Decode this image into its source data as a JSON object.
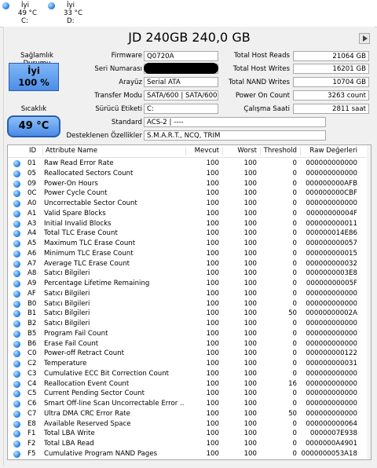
{
  "drives": [
    {
      "status": "İyi",
      "temp": "49 °C",
      "letter": "C:"
    },
    {
      "status": "İyi",
      "temp": "33 °C",
      "letter": "D:"
    }
  ],
  "title": "JD 240GB 240,0 GB",
  "health": {
    "label": "Sağlamlık Durumu",
    "status": "İyi",
    "percent": "100 %"
  },
  "temperature": {
    "label": "Sıcaklık",
    "value": "49 °C"
  },
  "info": {
    "firmware": {
      "label": "Firmware",
      "value": "Q0720A"
    },
    "serial": {
      "label": "Seri Numarası",
      "value": ""
    },
    "interface": {
      "label": "Arayüz",
      "value": "Serial ATA"
    },
    "transfer": {
      "label": "Transfer Modu",
      "value": "SATA/600 | SATA/600"
    },
    "drive_letter": {
      "label": "Sürücü Etiketi",
      "value": "C:"
    },
    "standard": {
      "label": "Standard",
      "value": "ACS-2 | ----"
    },
    "features": {
      "label": "Desteklenen Özellikler",
      "value": "S.M.A.R.T., NCQ, TRIM"
    }
  },
  "stats": {
    "host_reads": {
      "label": "Total Host Reads",
      "value": "21064 GB"
    },
    "host_writes": {
      "label": "Total Host Writes",
      "value": "16201 GB"
    },
    "nand_writes": {
      "label": "Total NAND Writes",
      "value": "10704 GB"
    },
    "power_on_count": {
      "label": "Power On Count",
      "value": "3263 count"
    },
    "power_on_hours": {
      "label": "Çalışma Saati",
      "value": "2811 saat"
    }
  },
  "columns": {
    "id": "ID",
    "attr": "Attribute Name",
    "current": "Mevcut",
    "worst": "Worst",
    "threshold": "Threshold",
    "raw": "Raw Değerleri"
  },
  "rows": [
    {
      "id": "01",
      "name": "Raw Read Error Rate",
      "cur": "100",
      "wor": "100",
      "thr": "0",
      "raw": "000000000000"
    },
    {
      "id": "05",
      "name": "Reallocated Sectors Count",
      "cur": "100",
      "wor": "100",
      "thr": "0",
      "raw": "000000000000"
    },
    {
      "id": "09",
      "name": "Power-On Hours",
      "cur": "100",
      "wor": "100",
      "thr": "0",
      "raw": "000000000AFB"
    },
    {
      "id": "0C",
      "name": "Power Cycle Count",
      "cur": "100",
      "wor": "100",
      "thr": "0",
      "raw": "000000000CBF"
    },
    {
      "id": "A0",
      "name": "Uncorrectable Sector Count",
      "cur": "100",
      "wor": "100",
      "thr": "0",
      "raw": "000000000000"
    },
    {
      "id": "A1",
      "name": "Valid Spare Blocks",
      "cur": "100",
      "wor": "100",
      "thr": "0",
      "raw": "00000000004F"
    },
    {
      "id": "A3",
      "name": "Initial Invalid Blocks",
      "cur": "100",
      "wor": "100",
      "thr": "0",
      "raw": "000000000011"
    },
    {
      "id": "A4",
      "name": "Total TLC Erase Count",
      "cur": "100",
      "wor": "100",
      "thr": "0",
      "raw": "000000014E86"
    },
    {
      "id": "A5",
      "name": "Maximum TLC Erase Count",
      "cur": "100",
      "wor": "100",
      "thr": "0",
      "raw": "000000000057"
    },
    {
      "id": "A6",
      "name": "Minimum TLC Erase Count",
      "cur": "100",
      "wor": "100",
      "thr": "0",
      "raw": "000000000015"
    },
    {
      "id": "A7",
      "name": "Average TLC Erase Count",
      "cur": "100",
      "wor": "100",
      "thr": "0",
      "raw": "000000000032"
    },
    {
      "id": "A8",
      "name": "Satıcı Bilgileri",
      "cur": "100",
      "wor": "100",
      "thr": "0",
      "raw": "0000000003E8"
    },
    {
      "id": "A9",
      "name": "Percentage Lifetime Remaining",
      "cur": "100",
      "wor": "100",
      "thr": "0",
      "raw": "00000000005F"
    },
    {
      "id": "AF",
      "name": "Satıcı Bilgileri",
      "cur": "100",
      "wor": "100",
      "thr": "0",
      "raw": "000000000000"
    },
    {
      "id": "B0",
      "name": "Satıcı Bilgileri",
      "cur": "100",
      "wor": "100",
      "thr": "0",
      "raw": "000000000000"
    },
    {
      "id": "B1",
      "name": "Satıcı Bilgileri",
      "cur": "100",
      "wor": "100",
      "thr": "50",
      "raw": "00000000002A"
    },
    {
      "id": "B2",
      "name": "Satıcı Bilgileri",
      "cur": "100",
      "wor": "100",
      "thr": "0",
      "raw": "000000000000"
    },
    {
      "id": "B5",
      "name": "Program Fail Count",
      "cur": "100",
      "wor": "100",
      "thr": "0",
      "raw": "000000000000"
    },
    {
      "id": "B6",
      "name": "Erase Fail Count",
      "cur": "100",
      "wor": "100",
      "thr": "0",
      "raw": "000000000000"
    },
    {
      "id": "C0",
      "name": "Power-off Retract Count",
      "cur": "100",
      "wor": "100",
      "thr": "0",
      "raw": "000000000122"
    },
    {
      "id": "C2",
      "name": "Temperature",
      "cur": "100",
      "wor": "100",
      "thr": "0",
      "raw": "000000000031"
    },
    {
      "id": "C3",
      "name": "Cumulative ECC Bit Correction Count",
      "cur": "100",
      "wor": "100",
      "thr": "0",
      "raw": "000000000000"
    },
    {
      "id": "C4",
      "name": "Reallocation Event Count",
      "cur": "100",
      "wor": "100",
      "thr": "16",
      "raw": "000000000000"
    },
    {
      "id": "C5",
      "name": "Current Pending Sector Count",
      "cur": "100",
      "wor": "100",
      "thr": "0",
      "raw": "000000000000"
    },
    {
      "id": "C6",
      "name": "Smart Off-line Scan Uncorrectable Error ...",
      "cur": "100",
      "wor": "100",
      "thr": "0",
      "raw": "000000000000"
    },
    {
      "id": "C7",
      "name": "Ultra DMA CRC Error Rate",
      "cur": "100",
      "wor": "100",
      "thr": "50",
      "raw": "000000000000"
    },
    {
      "id": "E8",
      "name": "Available Reserved Space",
      "cur": "100",
      "wor": "100",
      "thr": "0",
      "raw": "000000000064"
    },
    {
      "id": "F1",
      "name": "Total LBA Write",
      "cur": "100",
      "wor": "100",
      "thr": "0",
      "raw": "0000007E938"
    },
    {
      "id": "F2",
      "name": "Total LBA Read",
      "cur": "100",
      "wor": "100",
      "thr": "0",
      "raw": "0000000A4901"
    },
    {
      "id": "F5",
      "name": "Cumulative Program NAND Pages",
      "cur": "100",
      "wor": "100",
      "thr": "0",
      "raw": "0000000053A18"
    }
  ]
}
